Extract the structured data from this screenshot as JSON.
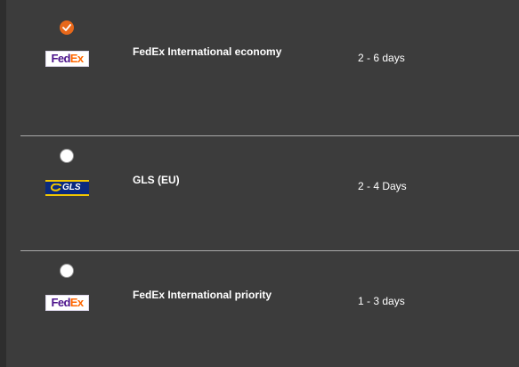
{
  "shipping_options": [
    {
      "carrier": "FedEx",
      "logo_parts": [
        "Fed",
        "Ex"
      ],
      "name": "FedEx International economy",
      "delivery_time": "2 - 6 days",
      "selected": true
    },
    {
      "carrier": "GLS",
      "logo_text": "GLS",
      "name": "GLS (EU)",
      "delivery_time": "2 - 4 Days",
      "selected": false
    },
    {
      "carrier": "FedEx",
      "logo_parts": [
        "Fed",
        "Ex"
      ],
      "name": "FedEx International priority",
      "delivery_time": "1 - 3 days",
      "selected": false
    }
  ],
  "colors": {
    "background": "#3c3c3c",
    "radio_checked": "#e8681a",
    "fedex_purple": "#4d148c",
    "fedex_orange": "#ff6600",
    "gls_blue": "#0b2a7e",
    "gls_yellow": "#f2c700"
  },
  "icons": {
    "checkmark": "check-icon"
  }
}
